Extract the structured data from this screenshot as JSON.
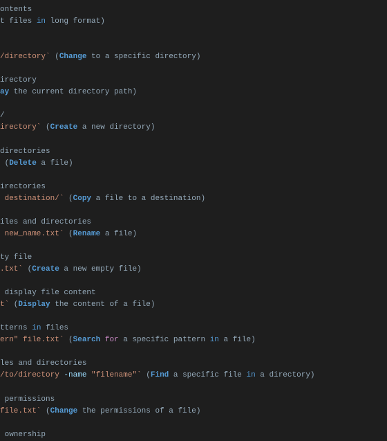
{
  "lines": [
    {
      "frags": [
        {
          "t": "ontents",
          "c": "c-plain"
        }
      ]
    },
    {
      "frags": [
        {
          "t": "t files ",
          "c": "c-plain"
        },
        {
          "t": "in",
          "c": "c-blue"
        },
        {
          "t": " long format)",
          "c": "c-plain"
        }
      ]
    },
    {
      "blank": true
    },
    {
      "blank": true
    },
    {
      "frags": [
        {
          "t": "/directory`",
          "c": "c-code"
        },
        {
          "t": " (",
          "c": "c-plain"
        },
        {
          "t": "Change",
          "c": "c-blue bold"
        },
        {
          "t": " to a specific directory)",
          "c": "c-plain"
        }
      ]
    },
    {
      "blank": true
    },
    {
      "frags": [
        {
          "t": "irectory",
          "c": "c-plain"
        }
      ]
    },
    {
      "frags": [
        {
          "t": "ay",
          "c": "c-blue bold"
        },
        {
          "t": " the current directory path)",
          "c": "c-plain"
        }
      ]
    },
    {
      "blank": true
    },
    {
      "frags": [
        {
          "t": "/",
          "c": "c-plain"
        }
      ]
    },
    {
      "frags": [
        {
          "t": "irectory`",
          "c": "c-code"
        },
        {
          "t": " (",
          "c": "c-plain"
        },
        {
          "t": "Create",
          "c": "c-blue bold"
        },
        {
          "t": " a new directory)",
          "c": "c-plain"
        }
      ]
    },
    {
      "blank": true
    },
    {
      "frags": [
        {
          "t": "directories",
          "c": "c-plain"
        }
      ]
    },
    {
      "frags": [
        {
          "t": " (",
          "c": "c-plain"
        },
        {
          "t": "Delete",
          "c": "c-blue bold"
        },
        {
          "t": " a file)",
          "c": "c-plain"
        }
      ]
    },
    {
      "blank": true
    },
    {
      "frags": [
        {
          "t": "irectories",
          "c": "c-plain"
        }
      ]
    },
    {
      "frags": [
        {
          "t": " destination/`",
          "c": "c-code"
        },
        {
          "t": " (",
          "c": "c-plain"
        },
        {
          "t": "Copy",
          "c": "c-blue bold"
        },
        {
          "t": " a file to a destination)",
          "c": "c-plain"
        }
      ]
    },
    {
      "blank": true
    },
    {
      "frags": [
        {
          "t": "iles and directories",
          "c": "c-plain"
        }
      ]
    },
    {
      "frags": [
        {
          "t": " new_name.txt`",
          "c": "c-code"
        },
        {
          "t": " (",
          "c": "c-plain"
        },
        {
          "t": "Rename",
          "c": "c-blue bold"
        },
        {
          "t": " a file)",
          "c": "c-plain"
        }
      ]
    },
    {
      "blank": true
    },
    {
      "frags": [
        {
          "t": "ty file",
          "c": "c-plain"
        }
      ]
    },
    {
      "frags": [
        {
          "t": ".txt`",
          "c": "c-code"
        },
        {
          "t": " (",
          "c": "c-plain"
        },
        {
          "t": "Create",
          "c": "c-blue bold"
        },
        {
          "t": " a new empty file)",
          "c": "c-plain"
        }
      ]
    },
    {
      "blank": true
    },
    {
      "frags": [
        {
          "t": " display file content",
          "c": "c-plain"
        }
      ]
    },
    {
      "frags": [
        {
          "t": "t`",
          "c": "c-code"
        },
        {
          "t": " (",
          "c": "c-plain"
        },
        {
          "t": "Display",
          "c": "c-blue bold"
        },
        {
          "t": " the content of a file)",
          "c": "c-plain"
        }
      ]
    },
    {
      "blank": true
    },
    {
      "frags": [
        {
          "t": "tterns ",
          "c": "c-plain"
        },
        {
          "t": "in",
          "c": "c-blue"
        },
        {
          "t": " files",
          "c": "c-plain"
        }
      ]
    },
    {
      "frags": [
        {
          "t": "ern\" file.txt`",
          "c": "c-code"
        },
        {
          "t": " (",
          "c": "c-plain"
        },
        {
          "t": "Search",
          "c": "c-blue bold"
        },
        {
          "t": " ",
          "c": "c-plain"
        },
        {
          "t": "for",
          "c": "c-kw"
        },
        {
          "t": " a specific pattern ",
          "c": "c-plain"
        },
        {
          "t": "in",
          "c": "c-blue"
        },
        {
          "t": " a file)",
          "c": "c-plain"
        }
      ]
    },
    {
      "blank": true
    },
    {
      "frags": [
        {
          "t": "les and directories",
          "c": "c-plain"
        }
      ]
    },
    {
      "frags": [
        {
          "t": "/to/directory ",
          "c": "c-code"
        },
        {
          "t": "-name",
          "c": "c-flag"
        },
        {
          "t": " ",
          "c": "c-plain"
        },
        {
          "t": "\"filename\"",
          "c": "c-str"
        },
        {
          "t": "`",
          "c": "c-code"
        },
        {
          "t": " (",
          "c": "c-plain"
        },
        {
          "t": "Find",
          "c": "c-blue bold"
        },
        {
          "t": " a specific file ",
          "c": "c-plain"
        },
        {
          "t": "in",
          "c": "c-blue"
        },
        {
          "t": " a directory)",
          "c": "c-plain"
        }
      ]
    },
    {
      "blank": true
    },
    {
      "frags": [
        {
          "t": " permissions",
          "c": "c-plain"
        }
      ]
    },
    {
      "frags": [
        {
          "t": "file.txt`",
          "c": "c-code"
        },
        {
          "t": " (",
          "c": "c-plain"
        },
        {
          "t": "Change",
          "c": "c-blue bold"
        },
        {
          "t": " the permissions of a file)",
          "c": "c-plain"
        }
      ]
    },
    {
      "blank": true
    },
    {
      "frags": [
        {
          "t": " ownership",
          "c": "c-plain"
        }
      ]
    }
  ]
}
